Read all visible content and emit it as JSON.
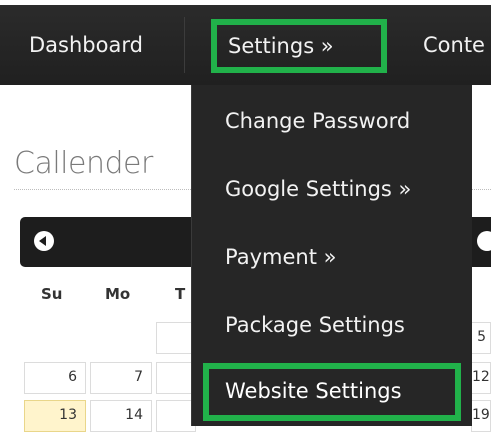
{
  "nav": {
    "dashboard": "Dashboard",
    "settings": "Settings »",
    "content": "Conte"
  },
  "page": {
    "title": "Callender"
  },
  "calendar": {
    "weekdays": [
      "Su",
      "Mo",
      "T"
    ],
    "rows": [
      [
        "",
        "",
        "",
        "5"
      ],
      [
        "6",
        "7",
        "",
        "12"
      ],
      [
        "13",
        "14",
        "",
        "19"
      ]
    ]
  },
  "dropdown": {
    "items": [
      "Change Password",
      "Google Settings »",
      "Payment »",
      "Package Settings",
      "Website Settings"
    ]
  },
  "colors": {
    "highlight": "#21b14a",
    "nav_bg": "#222222",
    "dropdown_bg": "#262626"
  }
}
